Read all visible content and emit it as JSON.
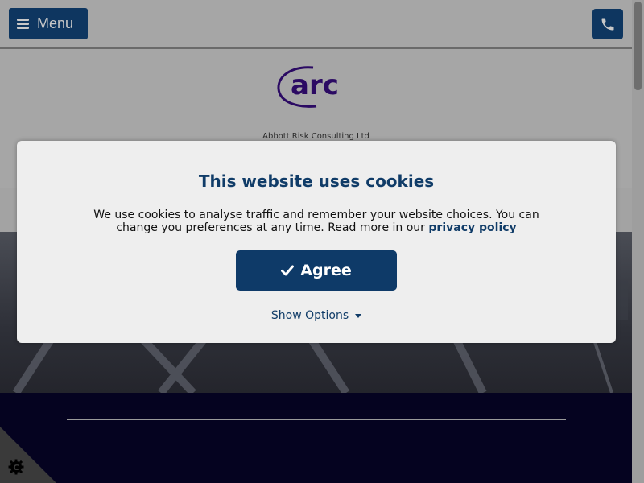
{
  "topbar": {
    "menu_label": "Menu",
    "menu_icon": "hamburger-icon",
    "phone_icon": "phone-icon"
  },
  "header": {
    "logo_text": "arc",
    "company_name": "Abbott Risk Consulting Ltd"
  },
  "cookie_banner": {
    "title": "This website uses cookies",
    "message": "We use cookies to analyse traffic and remember your website choices. You can change you preferences at any time. Read more in our",
    "link_text": "privacy policy",
    "agree_label": "Agree",
    "agree_icon": "checkmark-icon",
    "show_options_label": "Show Options",
    "show_options_icon": "caret-down-icon"
  },
  "cookie_settings": {
    "icon": "cookie-gear-icon"
  },
  "colors": {
    "brand_navy": "#0e3a68",
    "logo_purple": "#2b0a63",
    "dark_band": "#050320"
  }
}
